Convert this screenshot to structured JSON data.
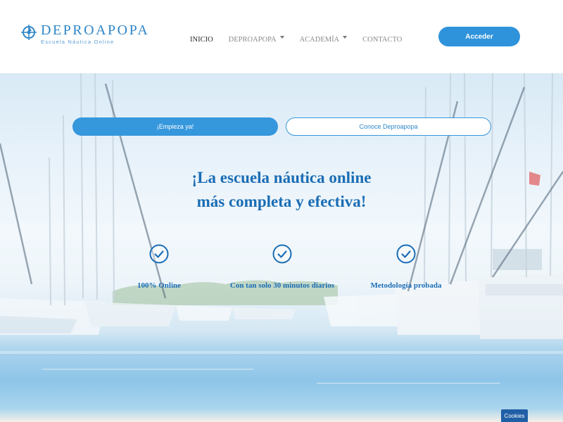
{
  "logo": {
    "title": "DEPROAPOPA",
    "subtitle": "Escuela Náutica Online"
  },
  "nav": {
    "items": [
      {
        "label": "INICIO",
        "dropdown": false,
        "active": true
      },
      {
        "label": "DEPROAPOPA",
        "dropdown": true,
        "active": false
      },
      {
        "label": "ACADEMÍA",
        "dropdown": true,
        "active": false
      },
      {
        "label": "CONTACTO",
        "dropdown": false,
        "active": false
      }
    ]
  },
  "header": {
    "login_label": "Acceder"
  },
  "hero": {
    "primary_button": "¡Empieza ya!",
    "secondary_button": "Conoce Deproapopa",
    "headline_line1": "¡La escuela náutica online",
    "headline_line2": "más completa y efectiva!",
    "features": [
      {
        "icon": "check-circle-icon",
        "text": "100% Online"
      },
      {
        "icon": "check-circle-icon",
        "text": "Con tan solo 30 minutos diarios"
      },
      {
        "icon": "check-circle-icon",
        "text": "Metodología probada"
      }
    ]
  },
  "cookies": {
    "label": "Cookies"
  },
  "colors": {
    "accent": "#2f93dc",
    "headline": "#1a6db5",
    "cookies_bg": "#1f5fa6"
  }
}
